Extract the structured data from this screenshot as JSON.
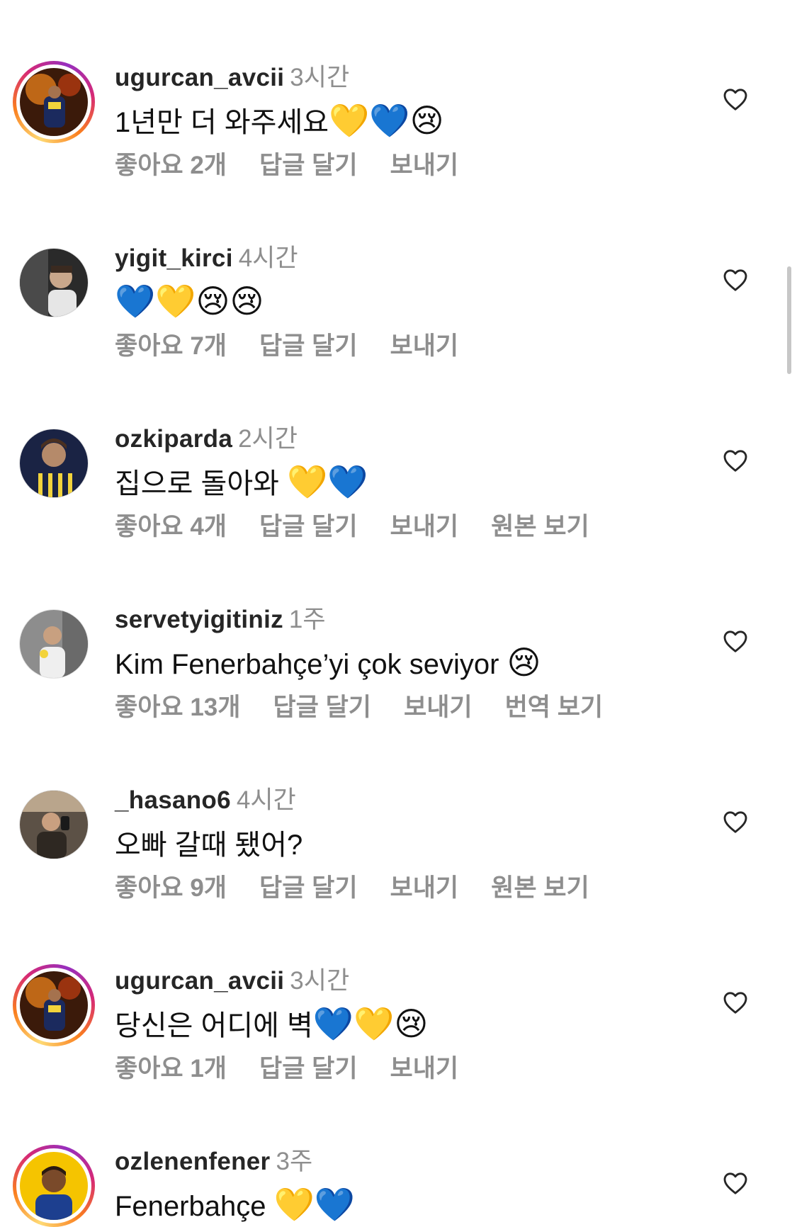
{
  "comments": [
    {
      "username": "ugurcan_avcii",
      "time": "3시간",
      "text": "1년만 더 와주세요",
      "emojis": "💛💙😢",
      "likes": "좋아요 2개",
      "reply": "답글 달기",
      "send": "보내기",
      "extra": "",
      "story_ring": true,
      "avatar_colors": [
        "#7a3b12",
        "#e07b1a",
        "#1b2a5e"
      ]
    },
    {
      "username": "yigit_kirci",
      "time": "4시간",
      "text": "",
      "emojis": "💙💛😢😢",
      "likes": "좋아요 7개",
      "reply": "답글 달기",
      "send": "보내기",
      "extra": "",
      "story_ring": false,
      "avatar_colors": [
        "#2a2a2a",
        "#c9a78b",
        "#6b4a3a"
      ]
    },
    {
      "username": "ozkiparda",
      "time": "2시간",
      "text": "집으로 돌아와 ",
      "emojis": "💛💙",
      "likes": "좋아요 4개",
      "reply": "답글 달기",
      "send": "보내기",
      "extra": "원본 보기",
      "story_ring": false,
      "avatar_colors": [
        "#1a2344",
        "#f2d33b",
        "#b58a6a"
      ]
    },
    {
      "username": "servetyigitiniz",
      "time": "1주",
      "text": "Kim Fenerbahçe’yi çok seviyor ",
      "emojis": "😢",
      "likes": "좋아요 13개",
      "reply": "답글 달기",
      "send": "보내기",
      "extra": "번역 보기",
      "story_ring": false,
      "avatar_colors": [
        "#8d8d8d",
        "#e8e8e8",
        "#5a5a5a"
      ]
    },
    {
      "username": "_hasano6",
      "time": "4시간",
      "text": "오빠 갈때 됐어?",
      "emojis": "",
      "likes": "좋아요 9개",
      "reply": "답글 달기",
      "send": "보내기",
      "extra": "원본 보기",
      "story_ring": false,
      "avatar_colors": [
        "#5c5146",
        "#b9a58c",
        "#2e2822"
      ]
    },
    {
      "username": "ugurcan_avcii",
      "time": "3시간",
      "text": "당신은 어디에 벽",
      "emojis": "💙💛😢",
      "likes": "좋아요 1개",
      "reply": "답글 달기",
      "send": "보내기",
      "extra": "",
      "story_ring": true,
      "avatar_colors": [
        "#7a3b12",
        "#e07b1a",
        "#1b2a5e"
      ]
    },
    {
      "username": "ozlenenfener",
      "time": "3주",
      "text": "Fenerbahçe ",
      "emojis": "💛💙",
      "likes": "",
      "reply": "",
      "send": "",
      "extra": "",
      "story_ring": true,
      "avatar_colors": [
        "#f5c400",
        "#7a4a2a",
        "#1d3f8f"
      ]
    }
  ]
}
